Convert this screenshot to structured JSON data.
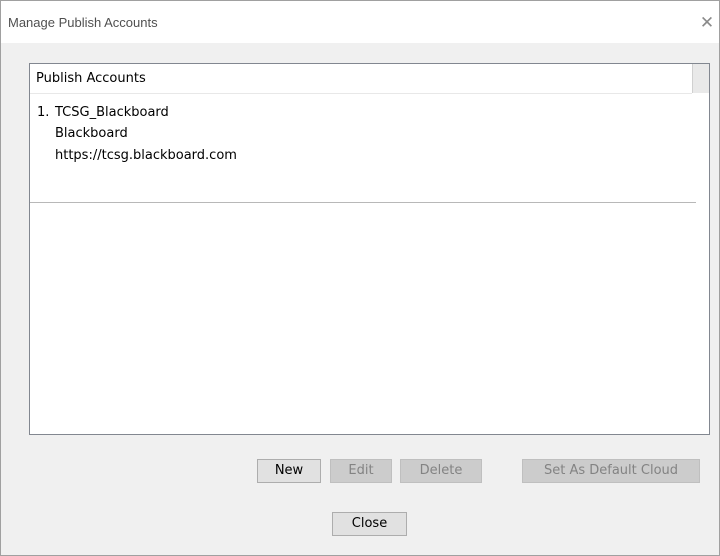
{
  "window": {
    "title": "Manage Publish Accounts",
    "close_glyph": "✕"
  },
  "list": {
    "header": "Publish Accounts",
    "items": [
      {
        "index": "1.",
        "name": "TCSG_Blackboard",
        "type": "Blackboard",
        "url": "https://tcsg.blackboard.com"
      }
    ]
  },
  "buttons": {
    "new": "New",
    "edit": "Edit",
    "delete": "Delete",
    "set_default": "Set As Default Cloud",
    "close": "Close"
  },
  "icons": {
    "window_close": "close-icon"
  }
}
